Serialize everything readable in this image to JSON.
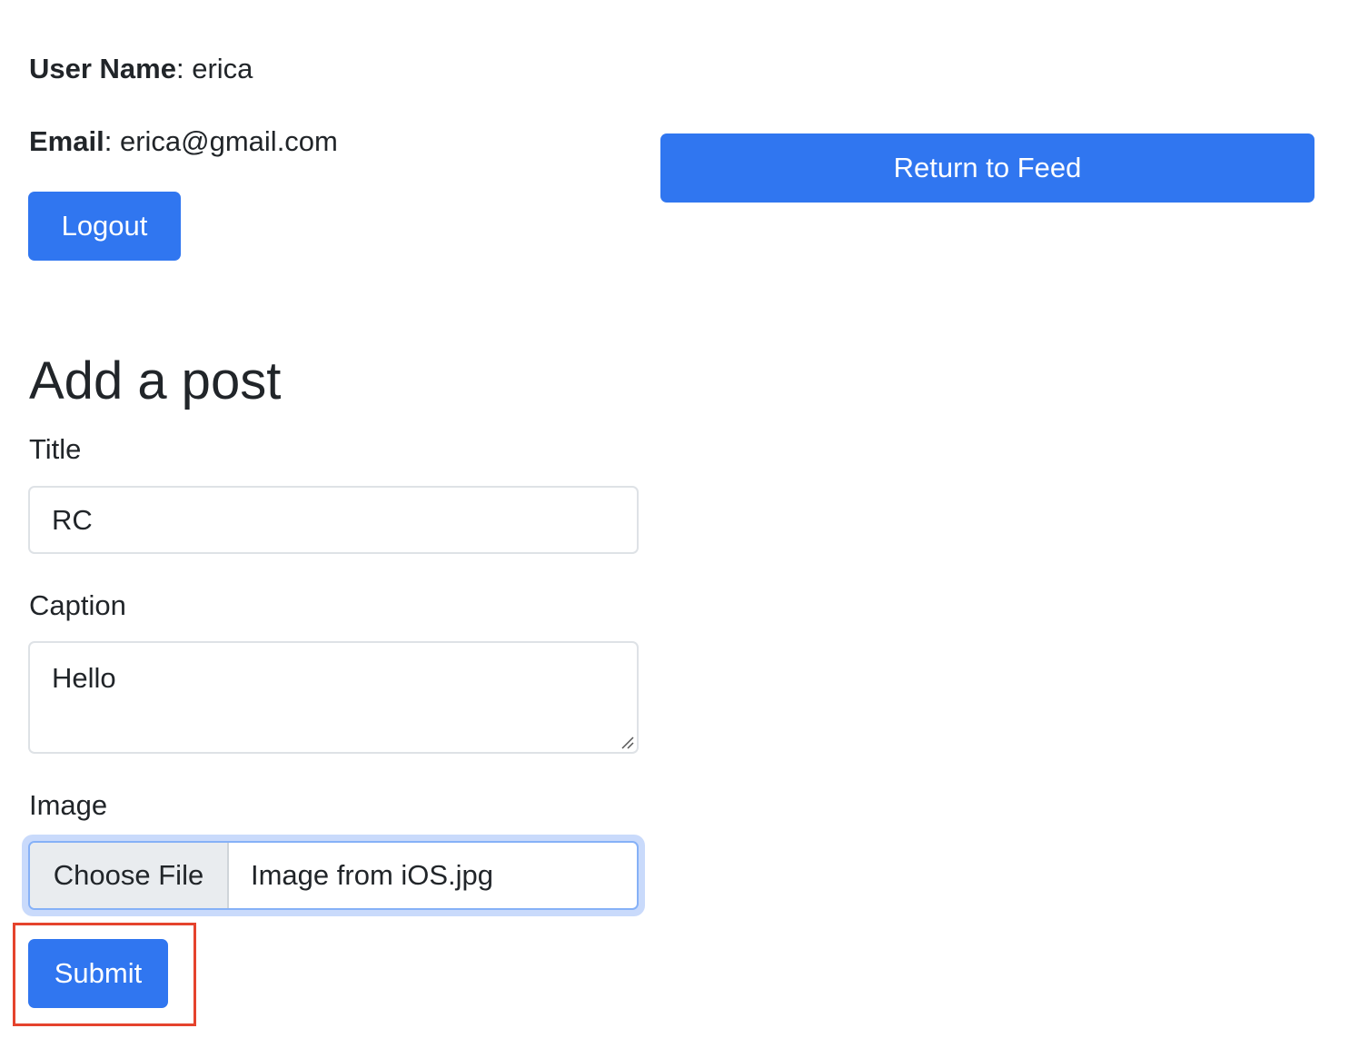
{
  "profile": {
    "username_label": "User Name",
    "username_value": "erica",
    "email_label": "Email",
    "email_value": "erica@gmail.com",
    "logout_label": "Logout"
  },
  "nav": {
    "return_label": "Return to Feed"
  },
  "form": {
    "heading": "Add a post",
    "title_label": "Title",
    "title_value": "RC",
    "caption_label": "Caption",
    "caption_value": "Hello",
    "image_label": "Image",
    "choose_file_label": "Choose File",
    "file_name": "Image from iOS.jpg",
    "submit_label": "Submit"
  },
  "colors": {
    "primary": "#3076f0",
    "highlight": "#e5432d",
    "focus_ring": "#c9dafb"
  }
}
